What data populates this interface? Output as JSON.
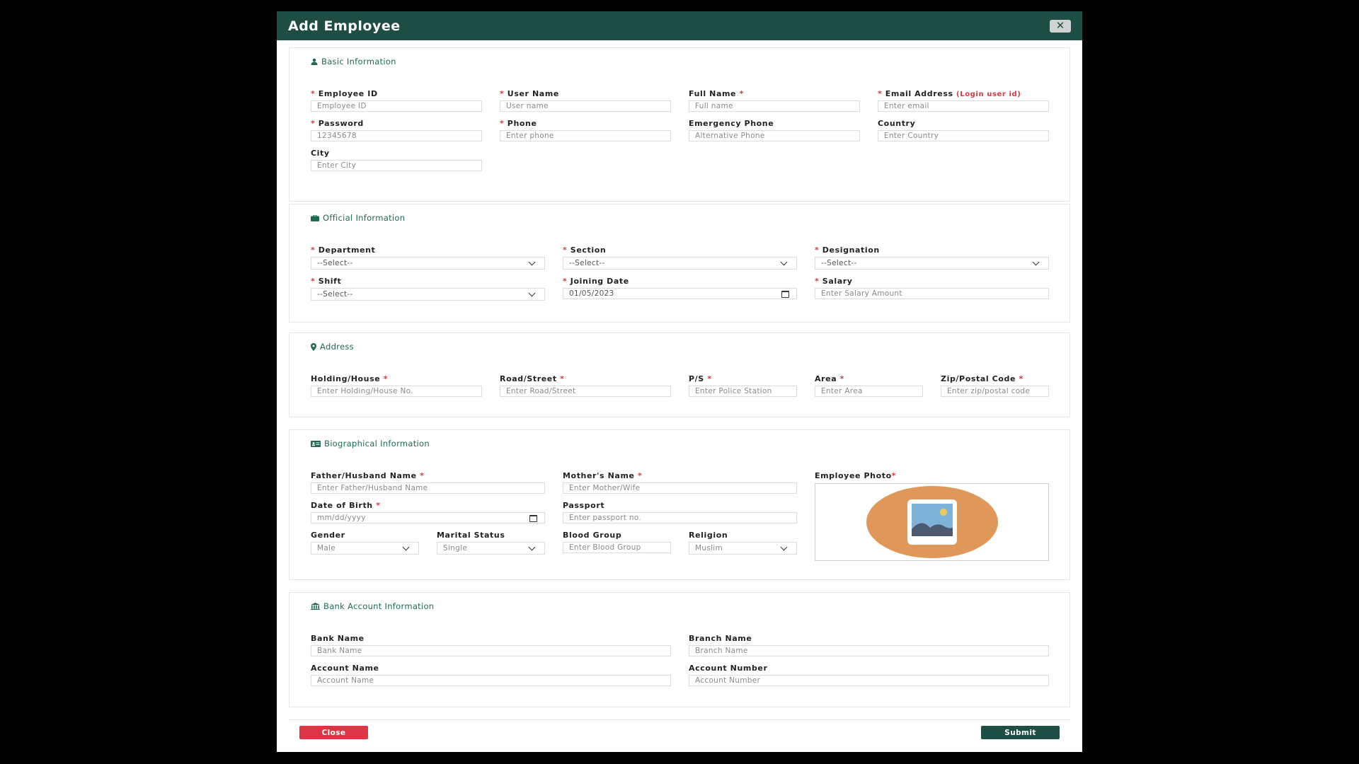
{
  "modal": {
    "title": "Add Employee",
    "close_icon": "close-icon"
  },
  "basic": {
    "title": "Basic Information",
    "employee_id": {
      "label": "Employee ID",
      "placeholder": "Employee ID"
    },
    "user_name": {
      "label": "User Name",
      "placeholder": "User name"
    },
    "full_name": {
      "label": "Full Name",
      "placeholder": "Full name"
    },
    "email": {
      "label": "Email Address",
      "note": "(Login user id)",
      "placeholder": "Enter email"
    },
    "password": {
      "label": "Password",
      "value": "12345678"
    },
    "phone": {
      "label": "Phone",
      "placeholder": "Enter phone"
    },
    "emergency_phone": {
      "label": "Emergency Phone",
      "placeholder": "Alternative Phone"
    },
    "country": {
      "label": "Country",
      "placeholder": "Enter Country"
    },
    "city": {
      "label": "City",
      "placeholder": "Enter City"
    }
  },
  "official": {
    "title": "Official Information",
    "department": {
      "label": "Department",
      "value": "--Select--"
    },
    "section": {
      "label": "Section",
      "value": "--Select--"
    },
    "designation": {
      "label": "Designation",
      "value": "--Select--"
    },
    "shift": {
      "label": "Shift",
      "value": "--Select--"
    },
    "joining_date": {
      "label": "Joining Date",
      "value": "01/05/2023"
    },
    "salary": {
      "label": "Salary",
      "placeholder": "Enter Salary Amount"
    }
  },
  "address": {
    "title": "Address",
    "holding": {
      "label": "Holding/House",
      "placeholder": "Enter Holding/House No."
    },
    "road": {
      "label": "Road/Street",
      "placeholder": "Enter Road/Street"
    },
    "ps": {
      "label": "P/S",
      "placeholder": "Enter Police Station"
    },
    "area": {
      "label": "Area",
      "placeholder": "Enter Area"
    },
    "zip": {
      "label": "Zip/Postal Code",
      "placeholder": "Enter zip/postal code"
    }
  },
  "bio": {
    "title": "Biographical Information",
    "father": {
      "label": "Father/Husband Name",
      "placeholder": "Enter Father/Husband Name"
    },
    "mother": {
      "label": "Mother's Name",
      "placeholder": "Enter Mother/Wife"
    },
    "photo": {
      "label": "Employee Photo",
      "req": "*"
    },
    "dob": {
      "label": "Date of Birth",
      "placeholder": "mm/dd/yyyy"
    },
    "passport": {
      "label": "Passport",
      "placeholder": "Enter passport no."
    },
    "gender": {
      "label": "Gender",
      "value": "Male"
    },
    "marital": {
      "label": "Marital Status",
      "value": "Single"
    },
    "blood": {
      "label": "Blood Group",
      "placeholder": "Enter Blood Group"
    },
    "religion": {
      "label": "Religion",
      "value": "Muslim"
    }
  },
  "bank": {
    "title": "Bank Account Information",
    "bank_name": {
      "label": "Bank Name",
      "placeholder": "Bank Name"
    },
    "branch_name": {
      "label": "Branch Name",
      "placeholder": "Branch Name"
    },
    "account_name": {
      "label": "Account Name",
      "placeholder": "Account Name"
    },
    "account_number": {
      "label": "Account Number",
      "placeholder": "Account Number"
    }
  },
  "footer": {
    "close_label": "Close",
    "submit_label": "Submit"
  },
  "colors": {
    "header": "#1e4e43",
    "accent": "#1e6a55",
    "danger": "#dc3545"
  }
}
